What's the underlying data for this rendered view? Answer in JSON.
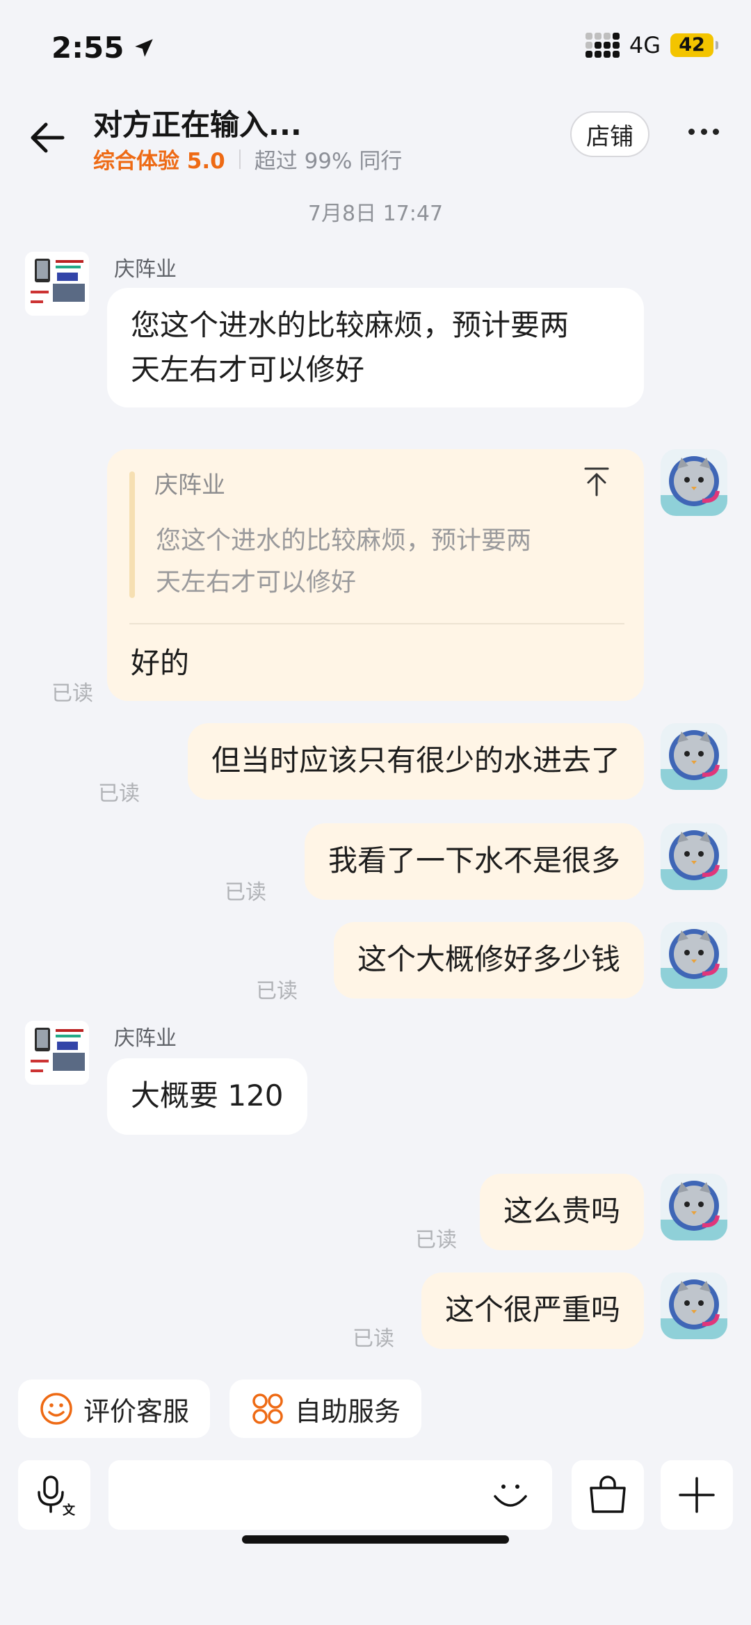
{
  "status_bar": {
    "time": "2:55",
    "network": "4G",
    "battery": "42"
  },
  "header": {
    "title": "对方正在输入...",
    "score": "综合体验 5.0",
    "peers": "超过 99% 同行",
    "shop_label": "店铺"
  },
  "chat": {
    "timestamp": "7月8日 17:47",
    "read_label": "已读",
    "messages": [
      {
        "from": "seller",
        "sender": "庆阵业",
        "text_lines": [
          "您这个进水的比较麻烦，预计要两",
          "天左右才可以修好"
        ]
      },
      {
        "from": "me",
        "quote": {
          "sender": "庆阵业",
          "lines": [
            "您这个进水的比较麻烦，预计要两",
            "天左右才可以修好"
          ]
        },
        "text": "好的",
        "status": "已读"
      },
      {
        "from": "me",
        "text": "但当时应该只有很少的水进去了",
        "status": "已读"
      },
      {
        "from": "me",
        "text": "我看了一下水不是很多",
        "status": "已读"
      },
      {
        "from": "me",
        "text": "这个大概修好多少钱",
        "status": "已读"
      },
      {
        "from": "seller",
        "sender": "庆阵业",
        "text": "大概要 120"
      },
      {
        "from": "me",
        "text": "这么贵吗",
        "status": "已读"
      },
      {
        "from": "me",
        "text": "这个很严重吗",
        "status": "已读"
      }
    ]
  },
  "quick_actions": [
    "评价客服",
    "自助服务"
  ],
  "colors": {
    "accent_orange": "#ee6a14",
    "outgoing_bubble": "#fff5e6",
    "background": "#f3f4f8"
  }
}
